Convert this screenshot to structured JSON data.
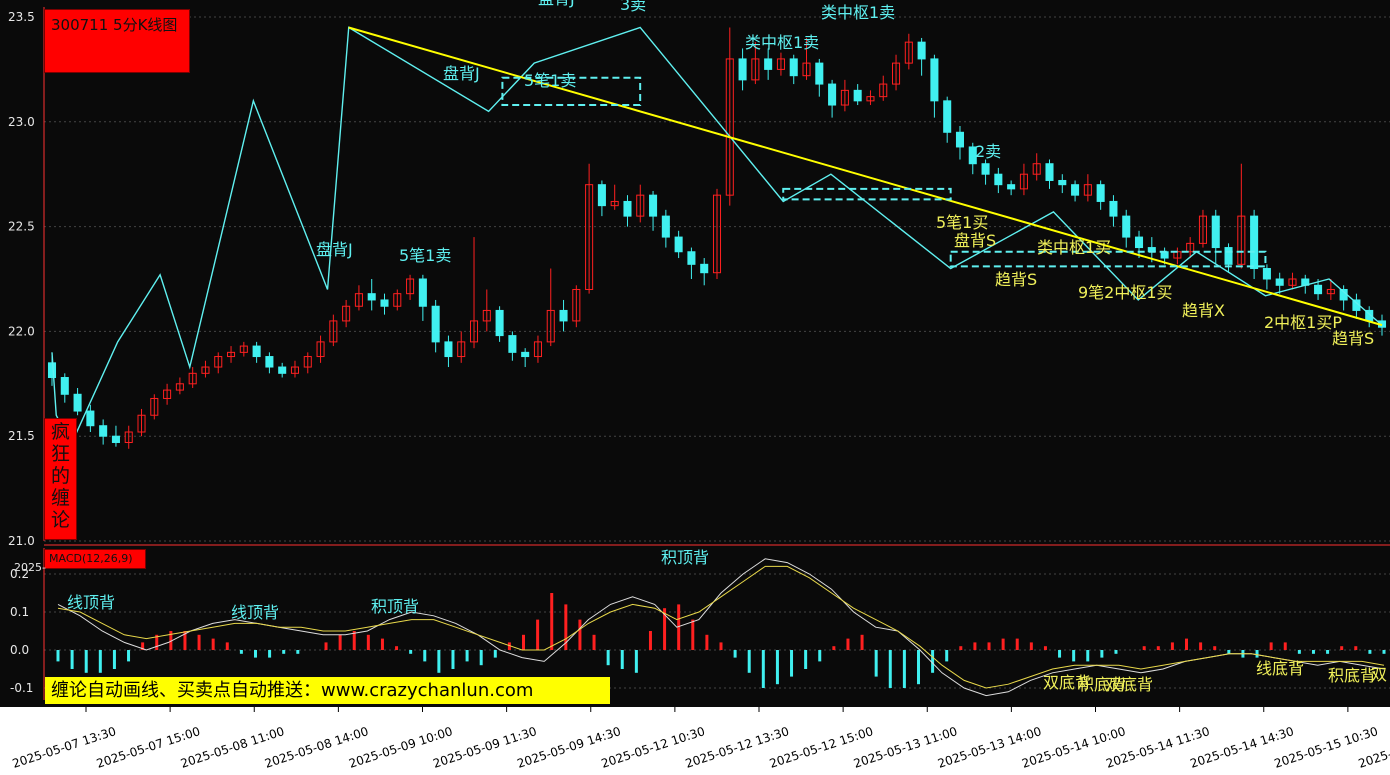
{
  "header": {
    "title": "300711 5分K线图",
    "brand": "疯狂的缠论",
    "macd_label": "MACD(12,26,9)",
    "macd_cut_label": "2025-",
    "promo": "缠论自动画线、买卖点自动推送：www.crazychanlun.com"
  },
  "colors": {
    "background": "#0a0a0a",
    "up_candle": "#ff2020",
    "down_candle": "#40f0f0",
    "stroke_line": "#5ff0f0",
    "trend_line": "#ffff00",
    "annotation_cyan": "#5ff0f0",
    "annotation_yellow": "#f0f05a",
    "axis_band": "#ffffff"
  },
  "chart_data": [
    {
      "type": "candlestick",
      "title": "300711 5分K线图",
      "ylim": [
        21.0,
        23.5
      ],
      "y_ticks": [
        "23.5",
        "23.0",
        "22.5",
        "22.0",
        "21.5",
        "21.0"
      ],
      "x_ticks": [
        "2025-05-07 13:30",
        "2025-05-07 15:00",
        "2025-05-08 11:00",
        "2025-05-08 14:00",
        "2025-05-09 10:00",
        "2025-05-09 11:30",
        "2025-05-09 14:30",
        "2025-05-12 10:30",
        "2025-05-12 13:30",
        "2025-05-12 15:00",
        "2025-05-13 11:00",
        "2025-05-13 14:00",
        "2025-05-14 10:00",
        "2025-05-14 11:30",
        "2025-05-14 14:30",
        "2025-05-15 10:30",
        "2025-05-15"
      ],
      "bi_strokes": [
        [
          0,
          21.9
        ],
        [
          4,
          21.6
        ],
        [
          18,
          21.46
        ],
        [
          62,
          21.95
        ],
        [
          102,
          22.27
        ],
        [
          130,
          21.83
        ],
        [
          190,
          23.1
        ],
        [
          260,
          22.2
        ],
        [
          280,
          23.45
        ],
        [
          412,
          23.05
        ],
        [
          455,
          23.28
        ],
        [
          555,
          23.45
        ],
        [
          690,
          22.62
        ],
        [
          735,
          22.75
        ],
        [
          848,
          22.3
        ],
        [
          945,
          22.57
        ],
        [
          1025,
          22.15
        ],
        [
          1080,
          22.38
        ],
        [
          1145,
          22.17
        ],
        [
          1205,
          22.25
        ],
        [
          1255,
          22.03
        ]
      ],
      "trend_lines": [
        [
          280,
          23.45,
          1255,
          22.03
        ]
      ],
      "zhongshu_boxes": [
        [
          425,
          23.21,
          555,
          23.08
        ],
        [
          690,
          22.68,
          848,
          22.63
        ],
        [
          848,
          22.38,
          1145,
          22.31
        ]
      ],
      "candles": [
        [
          0,
          21.85,
          21.78,
          21.9,
          21.74
        ],
        [
          1,
          21.78,
          21.7,
          21.8,
          21.66
        ],
        [
          2,
          21.7,
          21.62,
          21.73,
          21.6
        ],
        [
          3,
          21.62,
          21.55,
          21.65,
          21.52
        ],
        [
          4,
          21.55,
          21.5,
          21.58,
          21.46
        ],
        [
          5,
          21.5,
          21.47,
          21.55,
          21.45
        ],
        [
          6,
          21.47,
          21.52,
          21.55,
          21.44
        ],
        [
          7,
          21.52,
          21.6,
          21.63,
          21.5
        ],
        [
          8,
          21.6,
          21.68,
          21.7,
          21.58
        ],
        [
          9,
          21.68,
          21.72,
          21.75,
          21.65
        ],
        [
          10,
          21.72,
          21.75,
          21.78,
          21.7
        ],
        [
          11,
          21.75,
          21.8,
          21.83,
          21.73
        ],
        [
          12,
          21.8,
          21.83,
          21.86,
          21.78
        ],
        [
          13,
          21.83,
          21.88,
          21.9,
          21.8
        ],
        [
          14,
          21.88,
          21.9,
          21.93,
          21.85
        ],
        [
          15,
          21.9,
          21.93,
          21.95,
          21.88
        ],
        [
          16,
          21.93,
          21.88,
          21.95,
          21.85
        ],
        [
          17,
          21.88,
          21.83,
          21.9,
          21.8
        ],
        [
          18,
          21.83,
          21.8,
          21.85,
          21.78
        ],
        [
          19,
          21.8,
          21.83,
          21.86,
          21.78
        ],
        [
          20,
          21.83,
          21.88,
          21.9,
          21.8
        ],
        [
          21,
          21.88,
          21.95,
          21.98,
          21.85
        ],
        [
          22,
          21.95,
          22.05,
          22.08,
          21.93
        ],
        [
          23,
          22.05,
          22.12,
          22.15,
          22.02
        ],
        [
          24,
          22.12,
          22.18,
          22.22,
          22.1
        ],
        [
          25,
          22.18,
          22.15,
          22.25,
          22.1
        ],
        [
          26,
          22.15,
          22.12,
          22.18,
          22.08
        ],
        [
          27,
          22.12,
          22.18,
          22.2,
          22.1
        ],
        [
          28,
          22.18,
          22.25,
          22.27,
          22.15
        ],
        [
          29,
          22.25,
          22.12,
          22.27,
          22.05
        ],
        [
          30,
          22.12,
          21.95,
          22.15,
          21.9
        ],
        [
          31,
          21.95,
          21.88,
          21.98,
          21.83
        ],
        [
          32,
          21.88,
          21.95,
          22.0,
          21.85
        ],
        [
          33,
          21.95,
          22.05,
          22.45,
          21.92
        ],
        [
          34,
          22.05,
          22.1,
          22.2,
          22.0
        ],
        [
          35,
          22.1,
          21.98,
          22.12,
          21.95
        ],
        [
          36,
          21.98,
          21.9,
          22.0,
          21.86
        ],
        [
          37,
          21.9,
          21.88,
          21.92,
          21.83
        ],
        [
          38,
          21.88,
          21.95,
          21.98,
          21.85
        ],
        [
          39,
          21.95,
          22.1,
          22.3,
          21.93
        ],
        [
          40,
          22.1,
          22.05,
          22.15,
          22.0
        ],
        [
          41,
          22.05,
          22.2,
          22.22,
          22.02
        ],
        [
          42,
          22.2,
          22.7,
          22.8,
          22.18
        ],
        [
          43,
          22.7,
          22.6,
          22.72,
          22.55
        ],
        [
          44,
          22.6,
          22.62,
          22.7,
          22.58
        ],
        [
          45,
          22.62,
          22.55,
          22.65,
          22.5
        ],
        [
          46,
          22.55,
          22.65,
          22.7,
          22.52
        ],
        [
          47,
          22.65,
          22.55,
          22.67,
          22.48
        ],
        [
          48,
          22.55,
          22.45,
          22.58,
          22.4
        ],
        [
          49,
          22.45,
          22.38,
          22.48,
          22.35
        ],
        [
          50,
          22.38,
          22.32,
          22.4,
          22.25
        ],
        [
          51,
          22.32,
          22.28,
          22.35,
          22.22
        ],
        [
          52,
          22.28,
          22.65,
          22.68,
          22.25
        ],
        [
          53,
          22.65,
          23.3,
          23.45,
          22.6
        ],
        [
          54,
          23.3,
          23.2,
          23.35,
          23.15
        ],
        [
          55,
          23.2,
          23.3,
          23.38,
          23.18
        ],
        [
          56,
          23.3,
          23.25,
          23.35,
          23.2
        ],
        [
          57,
          23.25,
          23.3,
          23.33,
          23.22
        ],
        [
          58,
          23.3,
          23.22,
          23.32,
          23.18
        ],
        [
          59,
          23.22,
          23.28,
          23.4,
          23.2
        ],
        [
          60,
          23.28,
          23.18,
          23.3,
          23.12
        ],
        [
          61,
          23.18,
          23.08,
          23.2,
          23.02
        ],
        [
          62,
          23.08,
          23.15,
          23.2,
          23.05
        ],
        [
          63,
          23.15,
          23.1,
          23.18,
          23.08
        ],
        [
          64,
          23.1,
          23.12,
          23.15,
          23.08
        ],
        [
          65,
          23.12,
          23.18,
          23.22,
          23.1
        ],
        [
          66,
          23.18,
          23.28,
          23.32,
          23.15
        ],
        [
          67,
          23.28,
          23.38,
          23.42,
          23.25
        ],
        [
          68,
          23.38,
          23.3,
          23.4,
          23.22
        ],
        [
          69,
          23.3,
          23.1,
          23.32,
          23.02
        ],
        [
          70,
          23.1,
          22.95,
          23.12,
          22.9
        ],
        [
          71,
          22.95,
          22.88,
          22.98,
          22.82
        ],
        [
          72,
          22.88,
          22.8,
          22.9,
          22.75
        ],
        [
          73,
          22.8,
          22.75,
          22.82,
          22.7
        ],
        [
          74,
          22.75,
          22.7,
          22.78,
          22.66
        ],
        [
          75,
          22.7,
          22.68,
          22.72,
          22.65
        ],
        [
          76,
          22.68,
          22.75,
          22.8,
          22.65
        ],
        [
          77,
          22.75,
          22.8,
          22.85,
          22.72
        ],
        [
          78,
          22.8,
          22.72,
          22.82,
          22.68
        ],
        [
          79,
          22.72,
          22.7,
          22.75,
          22.66
        ],
        [
          80,
          22.7,
          22.65,
          22.72,
          22.62
        ],
        [
          81,
          22.65,
          22.7,
          22.75,
          22.62
        ],
        [
          82,
          22.7,
          22.62,
          22.72,
          22.58
        ],
        [
          83,
          22.62,
          22.55,
          22.65,
          22.5
        ],
        [
          84,
          22.55,
          22.45,
          22.58,
          22.4
        ],
        [
          85,
          22.45,
          22.4,
          22.48,
          22.35
        ],
        [
          86,
          22.4,
          22.38,
          22.45,
          22.33
        ],
        [
          87,
          22.38,
          22.35,
          22.4,
          22.32
        ],
        [
          88,
          22.35,
          22.38,
          22.4,
          22.32
        ],
        [
          89,
          22.38,
          22.42,
          22.45,
          22.35
        ],
        [
          90,
          22.42,
          22.55,
          22.58,
          22.4
        ],
        [
          91,
          22.55,
          22.4,
          22.58,
          22.32
        ],
        [
          92,
          22.4,
          22.32,
          22.42,
          22.28
        ],
        [
          93,
          22.32,
          22.55,
          22.8,
          22.3
        ],
        [
          94,
          22.55,
          22.3,
          22.58,
          22.25
        ],
        [
          95,
          22.3,
          22.25,
          22.32,
          22.2
        ],
        [
          96,
          22.25,
          22.22,
          22.28,
          22.18
        ],
        [
          97,
          22.22,
          22.25,
          22.28,
          22.2
        ],
        [
          98,
          22.25,
          22.22,
          22.27,
          22.18
        ],
        [
          99,
          22.22,
          22.18,
          22.25,
          22.15
        ],
        [
          100,
          22.18,
          22.2,
          22.25,
          22.15
        ],
        [
          101,
          22.2,
          22.15,
          22.22,
          22.1
        ],
        [
          102,
          22.15,
          22.1,
          22.18,
          22.06
        ],
        [
          103,
          22.1,
          22.05,
          22.12,
          22.02
        ],
        [
          104,
          22.05,
          22.02,
          22.08,
          21.98
        ]
      ]
    },
    {
      "type": "macd",
      "title": "MACD(12,26,9)",
      "ylim": [
        -0.1,
        0.2
      ],
      "y_ticks": [
        "0.2",
        "0.1",
        "0.0",
        "-0.1"
      ],
      "histogram": [
        -0.03,
        -0.05,
        -0.06,
        -0.06,
        -0.05,
        -0.03,
        0.02,
        0.04,
        0.05,
        0.05,
        0.04,
        0.03,
        0.02,
        -0.01,
        -0.02,
        -0.02,
        -0.01,
        -0.01,
        0.0,
        0.02,
        0.04,
        0.05,
        0.04,
        0.03,
        0.01,
        -0.01,
        -0.03,
        -0.06,
        -0.05,
        -0.03,
        -0.04,
        -0.02,
        0.02,
        0.04,
        0.08,
        0.15,
        0.12,
        0.08,
        0.04,
        -0.04,
        -0.05,
        -0.06,
        0.05,
        0.11,
        0.12,
        0.08,
        0.04,
        0.02,
        -0.02,
        -0.06,
        -0.1,
        -0.09,
        -0.07,
        -0.05,
        -0.03,
        0.01,
        0.03,
        0.04,
        -0.07,
        -0.1,
        -0.1,
        -0.09,
        -0.06,
        -0.03,
        0.01,
        0.02,
        0.02,
        0.03,
        0.03,
        0.02,
        0.01,
        -0.02,
        -0.03,
        -0.03,
        -0.02,
        -0.01,
        0.0,
        0.01,
        0.01,
        0.02,
        0.03,
        0.02,
        0.01,
        -0.01,
        -0.02,
        -0.02,
        0.02,
        0.02,
        -0.01,
        -0.01,
        -0.01,
        0.01,
        0.01,
        -0.01,
        -0.01
      ],
      "diff_line": [
        0.12,
        0.09,
        0.05,
        0.02,
        0.0,
        0.02,
        0.05,
        0.07,
        0.08,
        0.07,
        0.06,
        0.05,
        0.04,
        0.04,
        0.05,
        0.08,
        0.1,
        0.09,
        0.07,
        0.04,
        0.0,
        -0.02,
        -0.03,
        0.02,
        0.08,
        0.12,
        0.14,
        0.12,
        0.06,
        0.08,
        0.15,
        0.2,
        0.24,
        0.23,
        0.2,
        0.16,
        0.1,
        0.06,
        0.05,
        0.0,
        -0.06,
        -0.1,
        -0.12,
        -0.11,
        -0.08,
        -0.06,
        -0.05,
        -0.04,
        -0.05,
        -0.06,
        -0.05,
        -0.03,
        -0.02,
        -0.01,
        -0.01,
        -0.02,
        -0.03,
        -0.04,
        -0.03,
        -0.04,
        -0.05
      ],
      "dea_line": [
        0.11,
        0.1,
        0.07,
        0.04,
        0.03,
        0.04,
        0.05,
        0.06,
        0.07,
        0.07,
        0.06,
        0.06,
        0.05,
        0.05,
        0.06,
        0.07,
        0.08,
        0.08,
        0.06,
        0.04,
        0.02,
        0.0,
        0.0,
        0.03,
        0.07,
        0.1,
        0.12,
        0.11,
        0.08,
        0.1,
        0.14,
        0.18,
        0.22,
        0.22,
        0.19,
        0.15,
        0.11,
        0.08,
        0.05,
        0.01,
        -0.04,
        -0.08,
        -0.1,
        -0.09,
        -0.07,
        -0.05,
        -0.04,
        -0.04,
        -0.04,
        -0.05,
        -0.04,
        -0.03,
        -0.02,
        -0.01,
        -0.01,
        -0.02,
        -0.03,
        -0.03,
        -0.03,
        -0.03,
        -0.04
      ]
    }
  ],
  "annotations_cyan": [
    "盘背J",
    "5笔1卖",
    "盘背J",
    "5笔1卖",
    "类中枢1卖",
    "盘背J",
    "类中枢1卖",
    "2卖",
    "3卖"
  ],
  "annotations_yellow": [
    "5笔1买",
    "盘背S",
    "类中枢1买",
    "趋背S",
    "9笔2中枢1买",
    "趋背X",
    "2中枢1买P",
    "趋背S"
  ],
  "macd_annotations_cyan": [
    "线顶背",
    "线顶背",
    "积顶背",
    "积顶背"
  ],
  "macd_annotations_yellow": [
    "双底背",
    "积底背",
    "双底背",
    "线底背",
    "积底背",
    "双"
  ]
}
